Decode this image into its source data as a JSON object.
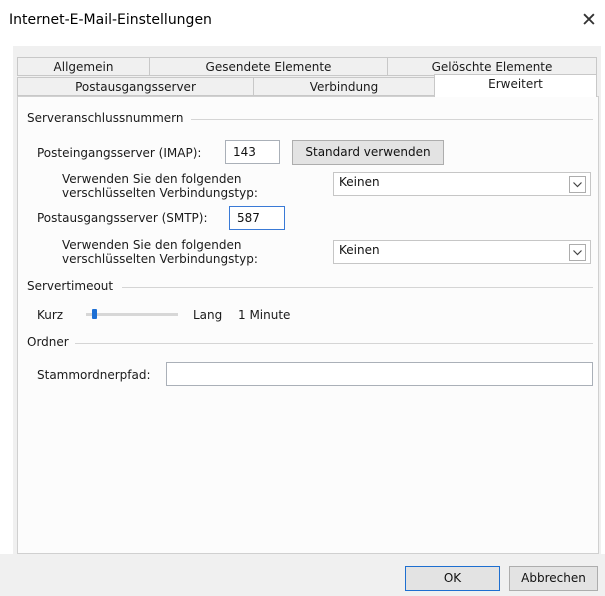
{
  "window": {
    "title": "Internet-E-Mail-Einstellungen",
    "close_glyph": "✕"
  },
  "tabs_row1": [
    {
      "label": "Allgemein"
    },
    {
      "label": "Gesendete Elemente"
    },
    {
      "label": "Gelöschte Elemente"
    }
  ],
  "tabs_row2": [
    {
      "label": "Postausgangsserver"
    },
    {
      "label": "Verbindung"
    },
    {
      "label": "Erweitert",
      "active": true
    }
  ],
  "ports": {
    "group_label": "Serveranschlussnummern",
    "imap_label": "Posteingangsserver (IMAP):",
    "imap_value": "143",
    "default_button": "Standard verwenden",
    "enc_label_line1": "Verwenden Sie den folgenden",
    "enc_label_line2": "verschlüsselten Verbindungstyp:",
    "imap_enc_value": "Keinen",
    "smtp_label": "Postausgangsserver (SMTP):",
    "smtp_value": "587",
    "smtp_enc_value": "Keinen"
  },
  "timeout": {
    "group_label": "Servertimeout",
    "short_label": "Kurz",
    "long_label": "Lang",
    "value_label": "1 Minute",
    "slider_fraction": 0.0
  },
  "folders": {
    "group_label": "Ordner",
    "root_label": "Stammordnerpfad:",
    "root_value": ""
  },
  "buttons": {
    "ok": "OK",
    "cancel": "Abbrechen"
  },
  "colors": {
    "accent": "#1e6fd0",
    "dialog_bg": "#f0f0f0"
  }
}
